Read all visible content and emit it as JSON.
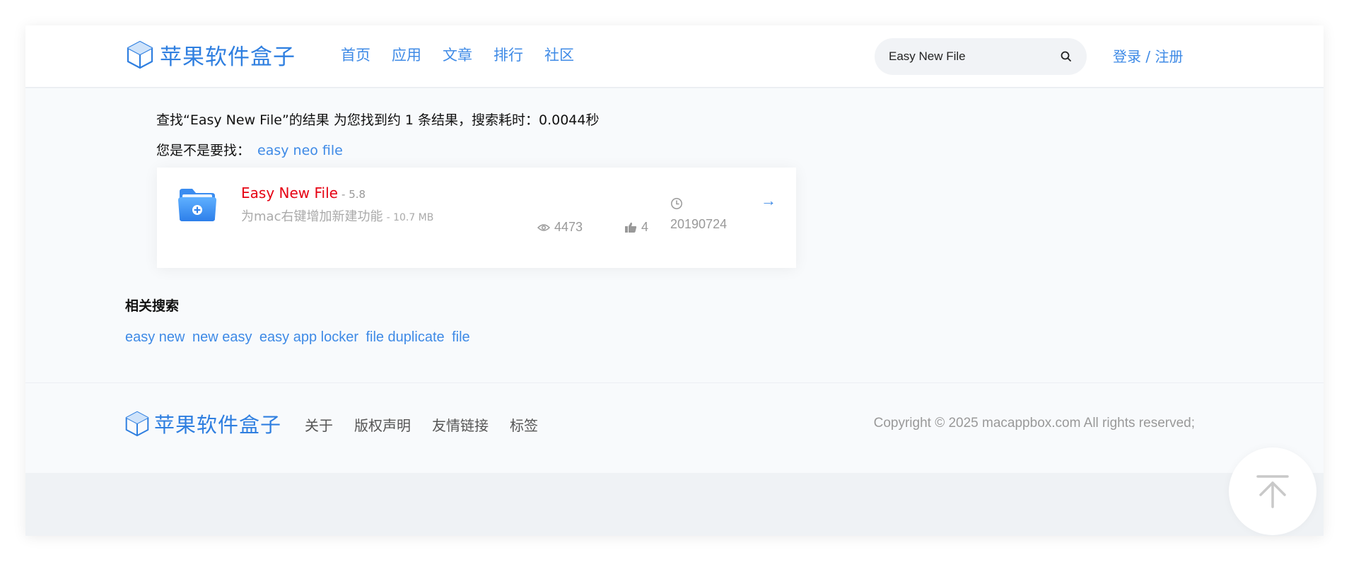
{
  "brand": {
    "name": "苹果软件盒子",
    "icon": "cube-icon",
    "color": "#2f7fe0"
  },
  "nav": {
    "items": [
      {
        "label": "首页"
      },
      {
        "label": "应用"
      },
      {
        "label": "文章"
      },
      {
        "label": "排行"
      },
      {
        "label": "社区"
      }
    ]
  },
  "search": {
    "value": "Easy New File",
    "icon": "search-icon"
  },
  "auth": {
    "label": "登录 / 注册"
  },
  "results": {
    "summary": "查找“Easy New File”的结果 为您找到约 1 条结果，搜索耗时：0.0044秒",
    "suggest_prefix": "您是不是要找：",
    "suggest_link": "easy neo file"
  },
  "app": {
    "icon": "folder-plus-icon",
    "name": "Easy New File",
    "version": "- 5.8",
    "description": "为mac右键增加新建功能",
    "size": "- 10.7 MB",
    "views": "4473",
    "likes": "4",
    "date": "20190724",
    "arrow": "→"
  },
  "related": {
    "title": "相关搜索",
    "links": [
      "easy new",
      "new easy",
      "easy app locker",
      "file duplicate",
      "file"
    ]
  },
  "footer": {
    "brand": "苹果软件盒子",
    "links": [
      "关于",
      "版权声明",
      "友情链接",
      "标签"
    ],
    "copyright": "Copyright © 2025 macappbox.com All rights reserved;"
  },
  "colors": {
    "accent": "#3e8ae6",
    "app_name": "#e60012",
    "muted": "#999999"
  }
}
